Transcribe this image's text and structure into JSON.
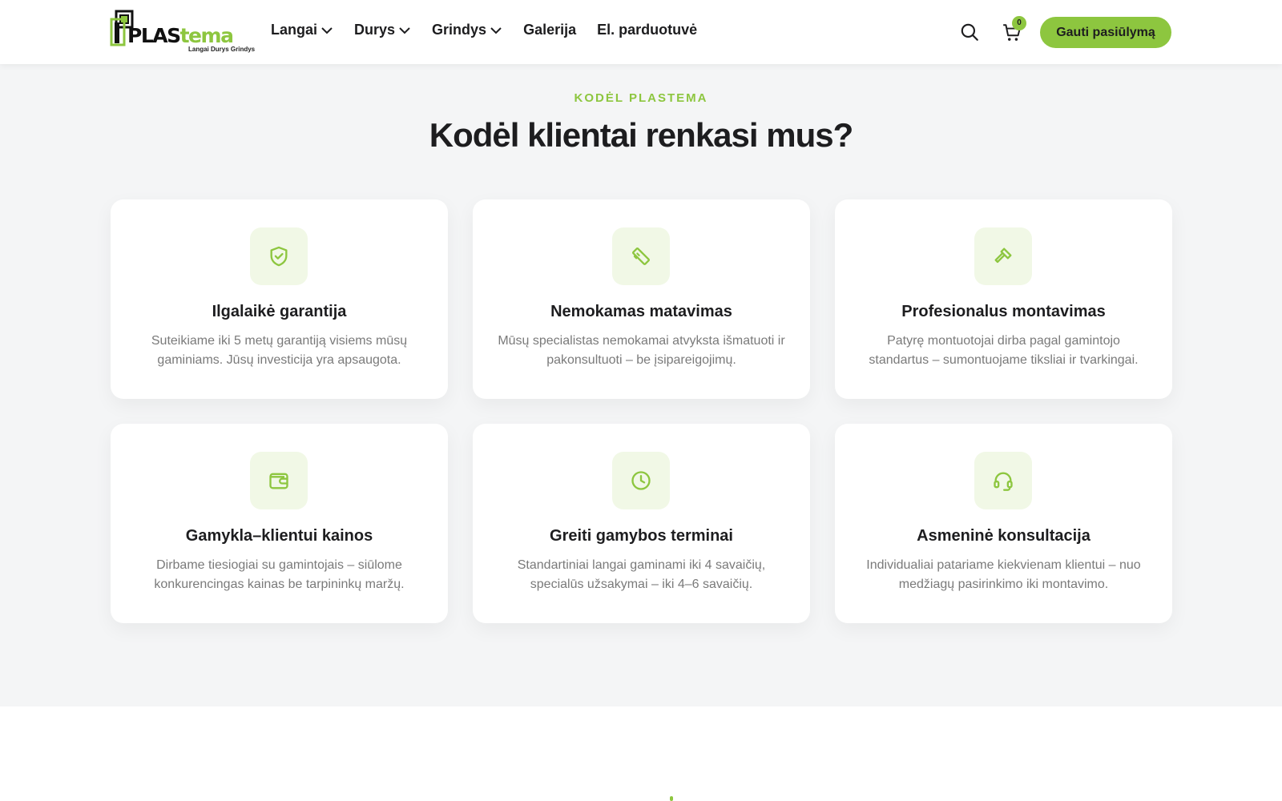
{
  "header": {
    "logo": {
      "brand_a": "PLAS",
      "brand_b": "tema",
      "tagline": "Langai Durys Grindys"
    },
    "nav": [
      {
        "label": "Langai",
        "has_dropdown": true
      },
      {
        "label": "Durys",
        "has_dropdown": true
      },
      {
        "label": "Grindys",
        "has_dropdown": true
      },
      {
        "label": "Galerija",
        "has_dropdown": false
      },
      {
        "label": "El. parduotuvė",
        "has_dropdown": false
      }
    ],
    "cart_count": "0",
    "cta_label": "Gauti pasiūlymą"
  },
  "section": {
    "eyebrow": "KODĖL PLASTEMA",
    "heading": "Kodėl klientai renkasi mus?",
    "cards": [
      {
        "icon": "shield-check-icon",
        "title": "Ilgalaikė garantija",
        "text": "Suteikiame iki 5 metų garantiją visiems mūsų gaminiams. Jūsų investicija yra apsaugota."
      },
      {
        "icon": "ruler-icon",
        "title": "Nemokamas matavimas",
        "text": "Mūsų specialistas nemokamai atvyksta išmatuoti ir pakonsultuoti – be įsipareigojimų."
      },
      {
        "icon": "hammer-icon",
        "title": "Profesionalus montavimas",
        "text": "Patyrę montuotojai dirba pagal gamintojo standartus – sumontuojame tiksliai ir tvarkingai."
      },
      {
        "icon": "wallet-icon",
        "title": "Gamykla–klientui kainos",
        "text": "Dirbame tiesiogiai su gamintojais – siūlome konkurencingas kainas be tarpininkų maržų."
      },
      {
        "icon": "clock-icon",
        "title": "Greiti gamybos terminai",
        "text": "Standartiniai langai gaminami iki 4 savaičių, specialūs užsakymai – iki 4–6 savaičių."
      },
      {
        "icon": "headset-icon",
        "title": "Asmeninė konsultacija",
        "text": "Individualiai patariame kiekvienam klientui – nuo medžiagų pasirinkimo iki montavimo."
      }
    ]
  },
  "colors": {
    "accent": "#8dc63f",
    "accent_soft": "#f1f8e6",
    "section_bg": "#f4f5f6",
    "text": "#1d1d1f",
    "muted": "#7a7a7a"
  }
}
